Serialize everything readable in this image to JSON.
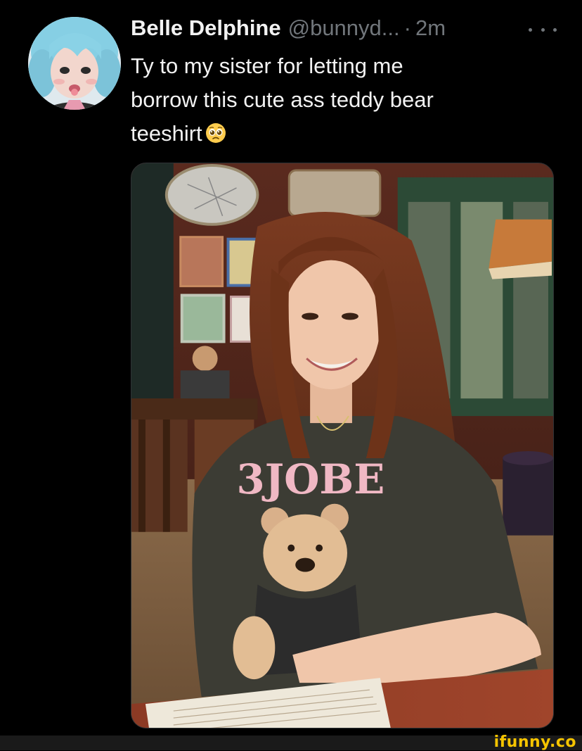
{
  "tweet": {
    "display_name": "Belle Delphine",
    "handle": "@bunnyd...",
    "separator": "·",
    "time": "2m",
    "more_icon": "more-horizontal-icon",
    "text": "Ty to my sister for letting me\nborrow this cute ass teddy bear\nteeshirt",
    "emoji": "pleading-face"
  },
  "media": {
    "shirt_text": "3JOBE"
  },
  "watermark": {
    "text": "ifunny.co"
  },
  "colors": {
    "background": "#000000",
    "primary_text": "#e7e9ea",
    "secondary_text": "#71767b",
    "watermark": "#f5c400"
  }
}
